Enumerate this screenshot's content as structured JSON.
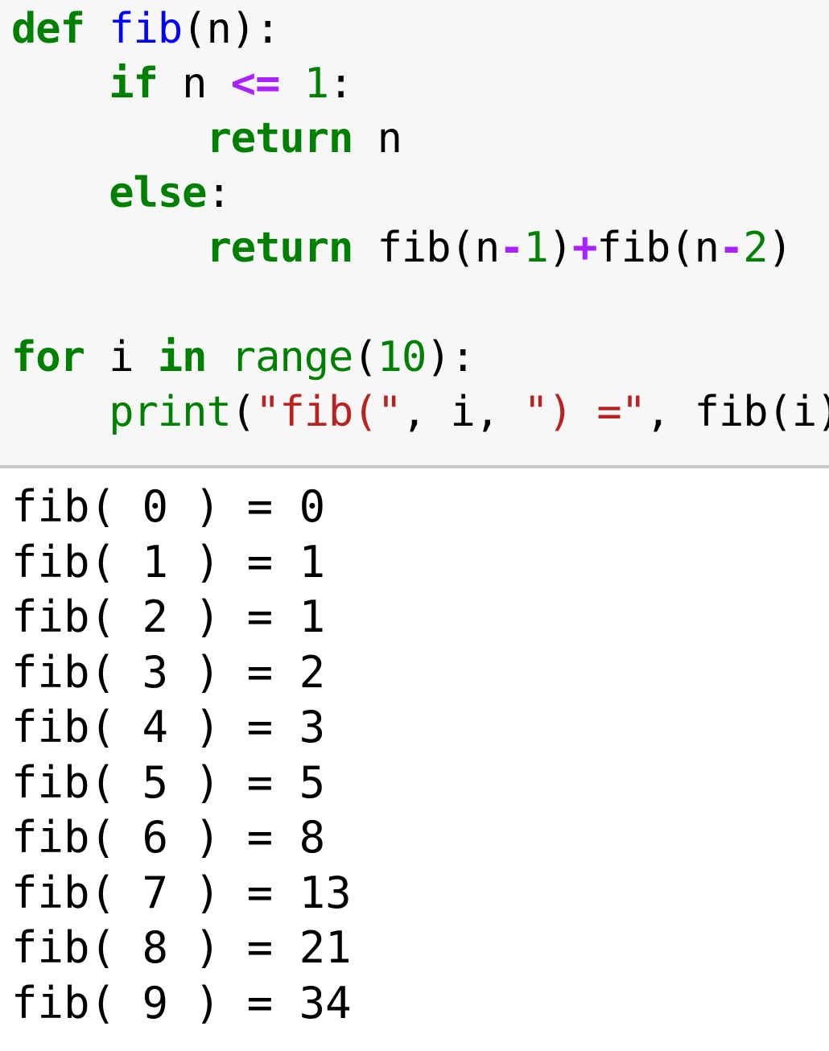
{
  "code": {
    "lines": [
      [
        {
          "t": "def",
          "c": "kw"
        },
        {
          "t": " ",
          "c": "plain"
        },
        {
          "t": "fib",
          "c": "fn"
        },
        {
          "t": "(n):",
          "c": "plain"
        }
      ],
      [
        {
          "t": "    ",
          "c": "plain"
        },
        {
          "t": "if",
          "c": "kw"
        },
        {
          "t": " n ",
          "c": "plain"
        },
        {
          "t": "<=",
          "c": "op"
        },
        {
          "t": " ",
          "c": "plain"
        },
        {
          "t": "1",
          "c": "num"
        },
        {
          "t": ":",
          "c": "plain"
        }
      ],
      [
        {
          "t": "        ",
          "c": "plain"
        },
        {
          "t": "return",
          "c": "kw"
        },
        {
          "t": " n",
          "c": "plain"
        }
      ],
      [
        {
          "t": "    ",
          "c": "plain"
        },
        {
          "t": "else",
          "c": "kw"
        },
        {
          "t": ":",
          "c": "plain"
        }
      ],
      [
        {
          "t": "        ",
          "c": "plain"
        },
        {
          "t": "return",
          "c": "kw"
        },
        {
          "t": " fib(n",
          "c": "plain"
        },
        {
          "t": "-",
          "c": "op"
        },
        {
          "t": "1",
          "c": "num"
        },
        {
          "t": ")",
          "c": "plain"
        },
        {
          "t": "+",
          "c": "op"
        },
        {
          "t": "fib(n",
          "c": "plain"
        },
        {
          "t": "-",
          "c": "op"
        },
        {
          "t": "2",
          "c": "num"
        },
        {
          "t": ")",
          "c": "plain"
        }
      ],
      [
        {
          "t": "",
          "c": "plain"
        }
      ],
      [
        {
          "t": "for",
          "c": "kw"
        },
        {
          "t": " i ",
          "c": "plain"
        },
        {
          "t": "in",
          "c": "kw"
        },
        {
          "t": " ",
          "c": "plain"
        },
        {
          "t": "range",
          "c": "bi"
        },
        {
          "t": "(",
          "c": "plain"
        },
        {
          "t": "10",
          "c": "num"
        },
        {
          "t": "):",
          "c": "plain"
        }
      ],
      [
        {
          "t": "    ",
          "c": "plain"
        },
        {
          "t": "print",
          "c": "bi"
        },
        {
          "t": "(",
          "c": "plain"
        },
        {
          "t": "\"fib(\"",
          "c": "str"
        },
        {
          "t": ", i, ",
          "c": "plain"
        },
        {
          "t": "\") =\"",
          "c": "str"
        },
        {
          "t": ", fib(i))",
          "c": "plain"
        }
      ]
    ]
  },
  "output": {
    "lines": [
      "fib( 0 ) = 0",
      "fib( 1 ) = 1",
      "fib( 2 ) = 1",
      "fib( 3 ) = 2",
      "fib( 4 ) = 3",
      "fib( 5 ) = 5",
      "fib( 6 ) = 8",
      "fib( 7 ) = 13",
      "fib( 8 ) = 21",
      "fib( 9 ) = 34"
    ]
  }
}
